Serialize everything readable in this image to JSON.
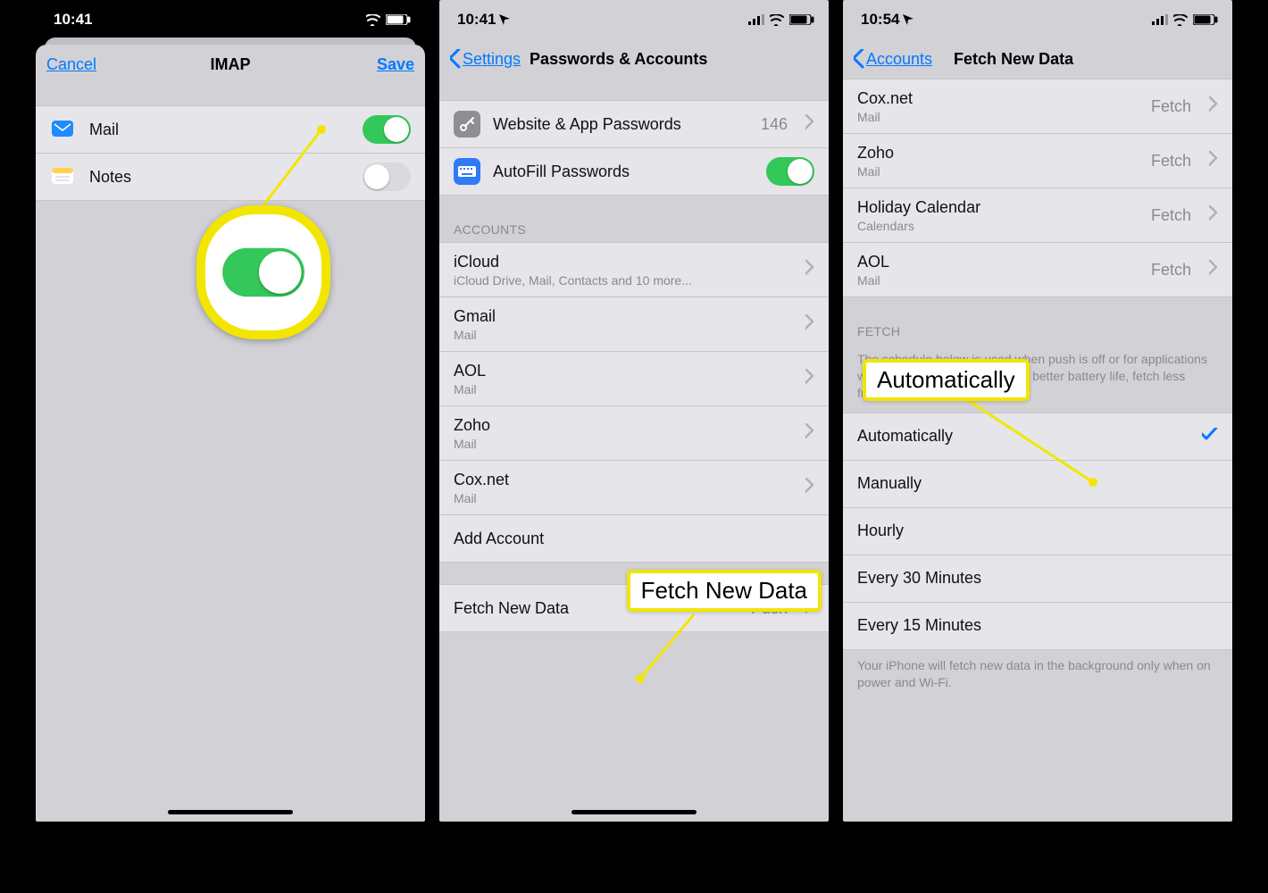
{
  "status": {
    "time1": "10:41",
    "time2": "10:41",
    "time3": "10:54"
  },
  "p1": {
    "cancel": "Cancel",
    "title": "IMAP",
    "save": "Save",
    "rows": [
      {
        "label": "Mail",
        "icon": "mail",
        "on": true
      },
      {
        "label": "Notes",
        "icon": "notes",
        "on": false
      }
    ]
  },
  "p2": {
    "back": "Settings",
    "title": "Passwords & Accounts",
    "row_webpw": {
      "label": "Website & App Passwords",
      "value": "146"
    },
    "row_autofill": {
      "label": "AutoFill Passwords"
    },
    "hdr_accounts": "Accounts",
    "accounts": [
      {
        "name": "iCloud",
        "sub": "iCloud Drive, Mail, Contacts and 10 more..."
      },
      {
        "name": "Gmail",
        "sub": "Mail"
      },
      {
        "name": "AOL",
        "sub": "Mail"
      },
      {
        "name": "Zoho",
        "sub": "Mail"
      },
      {
        "name": "Cox.net",
        "sub": "Mail"
      }
    ],
    "add": "Add Account",
    "fetch_label": "Fetch New Data",
    "fetch_value": "Push",
    "callout": "Fetch New Data"
  },
  "p3": {
    "back": "Accounts",
    "title": "Fetch New Data",
    "top_accounts": [
      {
        "name": "Cox.net",
        "sub": "Mail",
        "val": "Fetch"
      },
      {
        "name": "Zoho",
        "sub": "Mail",
        "val": "Fetch"
      },
      {
        "name": "Holiday Calendar",
        "sub": "Calendars",
        "val": "Fetch"
      },
      {
        "name": "AOL",
        "sub": "Mail",
        "val": "Fetch"
      }
    ],
    "hdr_fetch": "Fetch",
    "fetch_desc": "The schedule below is used when push is off or for applications which do not support push. For better battery life, fetch less frequently.",
    "options": [
      "Automatically",
      "Manually",
      "Hourly",
      "Every 30 Minutes",
      "Every 15 Minutes"
    ],
    "selected": 0,
    "footer": "Your iPhone will fetch new data in the background only when on power and Wi-Fi.",
    "callout": "Automatically"
  }
}
